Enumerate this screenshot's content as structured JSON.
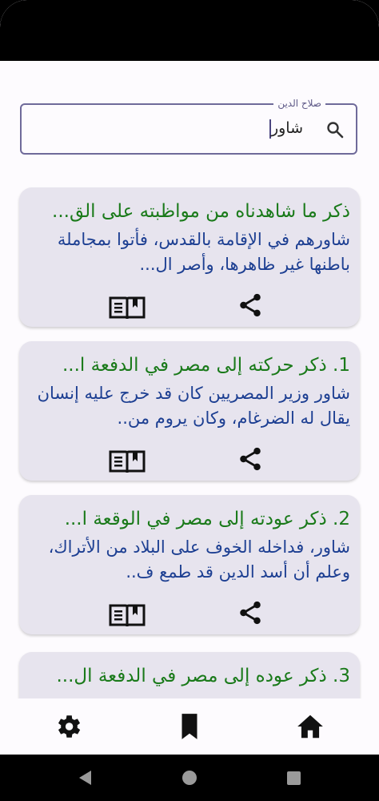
{
  "search": {
    "label": "صلاح الدين",
    "value": "شاور"
  },
  "results": [
    {
      "title": "ذكر ما شاهدناه من مواظبته على الق...",
      "snippet": "شاورهم في الإقامة بالقدس، فأتوا بمجاملة باطنها غير ظاهرها، وأصر ال..."
    },
    {
      "title": "1. ذكر حركته إلى مصر في الدفعة ا...",
      "snippet": "شاور وزير المصريين كان قد خرج عليه إنسان يقال له الضرغام، وكان يروم من.."
    },
    {
      "title": "2. ذكر عودته إلى مصر في الوقعة ا...",
      "snippet": "شاور، فداخله الخوف على البلاد من الأتراك، وعلم أن أسد الدين قد طمع ف.."
    },
    {
      "title": "3. ذكر عوده إلى مصر في الدفعة ال...",
      "snippet": ""
    }
  ],
  "icons": {
    "search": "search-icon",
    "share": "share-icon",
    "book": "book-icon",
    "settings": "gear-icon",
    "bookmark": "bookmark-icon",
    "home": "home-icon"
  },
  "colors": {
    "title": "#1a7a1a",
    "snippet": "#1d3f92",
    "card": "#e7e4ee",
    "outline": "#6f6a9a"
  }
}
